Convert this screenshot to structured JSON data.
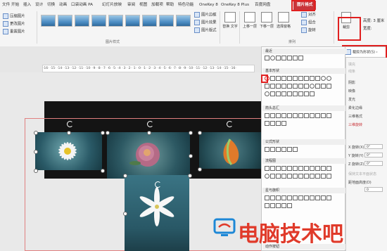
{
  "tabs": [
    {
      "label": "文件"
    },
    {
      "label": "开始"
    },
    {
      "label": "插入"
    },
    {
      "label": "设计"
    },
    {
      "label": "切换"
    },
    {
      "label": "动画"
    },
    {
      "label": "口袋动画 PA"
    },
    {
      "label": "幻灯片放映"
    },
    {
      "label": "审阅"
    },
    {
      "label": "视图"
    },
    {
      "label": "加载项"
    },
    {
      "label": "帮助"
    },
    {
      "label": "特色功能"
    },
    {
      "label": "OneKey 8"
    },
    {
      "label": "OneKey 8 Plus"
    },
    {
      "label": "百度网盘"
    },
    {
      "label": "图片格式"
    }
  ],
  "adjust": {
    "compress": "压缩图片",
    "change": "更改图片",
    "reset": "重置图片"
  },
  "picture_styles_label": "图片样式",
  "style_options": {
    "border": "图片边框",
    "effects": "图片效果",
    "layout": "图片版式"
  },
  "accessibility": {
    "alt_text": "替换\n文字"
  },
  "arrange": {
    "bring_forward": "上移一层",
    "send_backward": "下移一层",
    "selection_pane": "选择窗格",
    "align": "对齐",
    "group": "组合",
    "rotate": "旋转",
    "label": "排列"
  },
  "size": {
    "crop": "裁剪",
    "height_label": "高度:",
    "height_value": "3 厘米",
    "width_label": "宽度:"
  },
  "submenu": {
    "crop_to_shape": "裁剪为形状(S)"
  },
  "dropdown": {
    "recent": "最近",
    "basic": "基本形状",
    "block_arrows": "箭头总汇",
    "equations": "公式形状",
    "flowchart": "流程图",
    "stars": "星与旗帜",
    "action": "动作按钮"
  },
  "right_pane": {
    "items": [
      "填充",
      "线条",
      "阴影",
      "映像",
      "发光",
      "柔化边缘",
      "三维格式",
      "三维旋转"
    ],
    "x_rotation_label": "X 旋转(X)",
    "y_rotation_label": "Y 旋转(Y)",
    "z_rotation_label": "Z 旋转(Z)",
    "x_value": "0°",
    "y_value": "0°",
    "z_value": "0°",
    "keep_text_flat": "保持文本平面状态",
    "distance_label": "距地面高度(D)",
    "distance_value": "0"
  },
  "ruler_text": "·16· ·15· ·14· ·13· ·12· ·11· ·10· ·9· ·8· ·7· ·6· ·5· ·4· ·3· ·2· ·1· ·0· ·1· ·2· ·3· ·4· ·5· ·6· ·7· ·8· ·9· ·10· ·11· ·12· ·13· ·14· ·15· ·16·",
  "watermark": {
    "text": "电脑技术吧",
    "color": "#e03a2a",
    "logo_color": "#1e88d6"
  },
  "colors": {
    "accent": "#c9353a",
    "highlight": "#e02020",
    "slide_bg": "#141414"
  }
}
